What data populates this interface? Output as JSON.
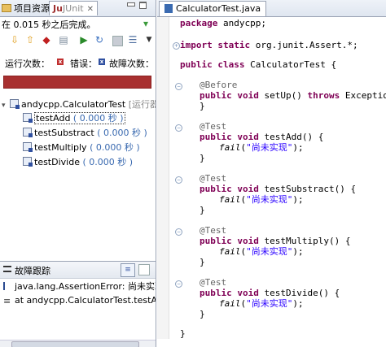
{
  "left_panel": {
    "tabs": [
      {
        "label": "项目资源"
      },
      {
        "label": "JUnit"
      }
    ],
    "finished_text": "在 0.015 秒之后完成。",
    "counters": {
      "runs_label": "运行次数：",
      "errors_label": "错误：",
      "failures_label": "故障次数：",
      "error_icon_glyph": "x",
      "failure_icon_glyph": "x"
    },
    "progress": {
      "status": "failed",
      "color": "#a83030",
      "fraction": 1.0
    },
    "tree": {
      "root": {
        "label": "andycpp.CalculatorTest",
        "extra": "[运行器"
      },
      "tests": [
        {
          "name": "testAdd",
          "time": "( 0.000 秒 )"
        },
        {
          "name": "testSubstract",
          "time": "( 0.000 秒 )"
        },
        {
          "name": "testMultiply",
          "time": "( 0.000 秒 )"
        },
        {
          "name": "testDivide",
          "time": "( 0.000 秒 )"
        }
      ]
    },
    "trace": {
      "title": "故障跟踪",
      "lines": [
        "java.lang.AssertionError: 尚未实现",
        "at andycpp.CalculatorTest.testAdd"
      ]
    }
  },
  "editor": {
    "tab_label": "CalculatorTest.java",
    "code": {
      "package": {
        "kw": "package",
        "rest": " andycpp;"
      },
      "import": {
        "kw1": "import",
        "kw2": "static",
        "rest": " org.junit.Assert.*;"
      },
      "class_decl": {
        "kw1": "public",
        "kw2": "class",
        "rest": " CalculatorTest {"
      },
      "methods": [
        {
          "annotation": "@Before",
          "signature": "setUp()",
          "throws": "throws",
          "exc": " Exception {",
          "body_fn": "",
          "body_str": ""
        },
        {
          "annotation": "@Test",
          "signature": "testAdd() {",
          "throws": "",
          "exc": "",
          "body_fn": "fail",
          "body_str": "\"尚未实现\""
        },
        {
          "annotation": "@Test",
          "signature": "testSubstract() {",
          "throws": "",
          "exc": "",
          "body_fn": "fail",
          "body_str": "\"尚未实现\""
        },
        {
          "annotation": "@Test",
          "signature": "testMultiply() {",
          "throws": "",
          "exc": "",
          "body_fn": "fail",
          "body_str": "\"尚未实现\""
        },
        {
          "annotation": "@Test",
          "signature": "testDivide() {",
          "throws": "",
          "exc": "",
          "body_fn": "fail",
          "body_str": "\"尚未实现\""
        }
      ],
      "public_kw": "public",
      "void_kw": "void",
      "close_brace": "}",
      "class_close": "}"
    }
  }
}
